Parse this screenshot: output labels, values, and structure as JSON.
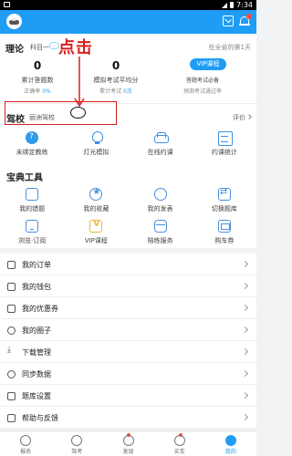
{
  "status_bar": {
    "time": "7:34"
  },
  "header": {
    "avatar_icon": "avatar-icon",
    "mail_icon": "mail-icon",
    "bell_icon": "bell-icon"
  },
  "theory": {
    "title": "理论",
    "subject": "科目一",
    "rank": "在全省的第1天",
    "stats": [
      {
        "value": "0",
        "label": "累计答题数",
        "sub": "正确率",
        "sub_value": "0%"
      },
      {
        "value": "0",
        "label": "模拟考试平均分",
        "sub": "累计考试",
        "sub_value": "0次"
      }
    ],
    "vip_button": "VIP课程",
    "vip_sub1": "答题考试必备",
    "vip_sub2": "预测考试通过率"
  },
  "annotation": {
    "text": "点击"
  },
  "school": {
    "title": "驾校",
    "name": "丽洲驾校",
    "rate_label": "评价",
    "items": [
      {
        "label": "未绑定教练",
        "icon": "question-icon"
      },
      {
        "label": "灯光模拟",
        "icon": "lightbulb-icon"
      },
      {
        "label": "在线约课",
        "icon": "car-icon"
      },
      {
        "label": "约课统计",
        "icon": "statistics-icon"
      }
    ]
  },
  "tools": {
    "title": "宝典工具",
    "row1": [
      {
        "label": "我的错题",
        "icon": "error-book-icon"
      },
      {
        "label": "我的收藏",
        "icon": "star-icon"
      },
      {
        "label": "我的发表",
        "icon": "comment-icon"
      },
      {
        "label": "切换题库",
        "icon": "switch-icon"
      }
    ],
    "row2": [
      {
        "label": "浏览·订阅",
        "icon": "subscribe-icon"
      },
      {
        "label": "VIP课程",
        "icon": "vip-icon"
      },
      {
        "label": "陪练服务",
        "icon": "coach-service-icon"
      },
      {
        "label": "购车券",
        "icon": "car-coupon-icon"
      }
    ]
  },
  "menu": [
    {
      "label": "我的订单",
      "icon": "order-icon"
    },
    {
      "label": "我的钱包",
      "icon": "wallet-icon"
    },
    {
      "label": "我的优惠券",
      "icon": "coupon-icon"
    },
    {
      "label": "我的圈子",
      "icon": "circle-icon"
    },
    {
      "label": "下载管理",
      "icon": "download-icon"
    },
    {
      "label": "同步数据",
      "icon": "sync-icon"
    },
    {
      "label": "题库设置",
      "icon": "settings-icon"
    },
    {
      "label": "帮助与反馈",
      "icon": "help-icon"
    }
  ],
  "tabbar": [
    {
      "label": "报名",
      "icon": "signup-icon",
      "dot": false,
      "active": false
    },
    {
      "label": "驾考",
      "icon": "exam-icon",
      "dot": false,
      "active": false
    },
    {
      "label": "发现",
      "icon": "discover-icon",
      "dot": true,
      "active": false
    },
    {
      "label": "买车",
      "icon": "buy-car-icon",
      "dot": true,
      "active": false
    },
    {
      "label": "我的",
      "icon": "profile-icon",
      "dot": false,
      "active": true
    }
  ],
  "colors": {
    "brand": "#1f9df5",
    "annotation": "#d61f1f"
  }
}
